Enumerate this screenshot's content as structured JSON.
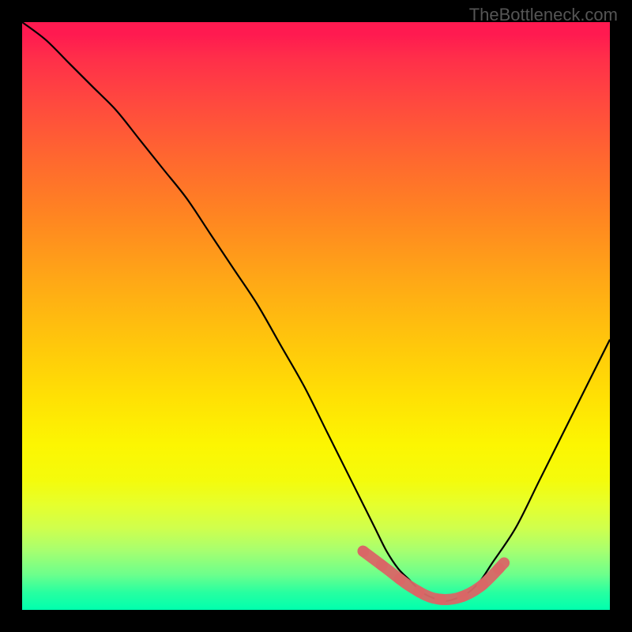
{
  "watermark": "TheBottleneck.com",
  "chart_data": {
    "type": "line",
    "title": "",
    "xlabel": "",
    "ylabel": "",
    "xlim": [
      0,
      100
    ],
    "ylim": [
      0,
      100
    ],
    "series": [
      {
        "name": "bottleneck-curve",
        "x": [
          0,
          4,
          8,
          12,
          16,
          20,
          24,
          28,
          32,
          36,
          40,
          44,
          48,
          52,
          56,
          58,
          60,
          62,
          64,
          66,
          68,
          70,
          72,
          74,
          76,
          78,
          80,
          84,
          88,
          92,
          96,
          100
        ],
        "values": [
          100,
          97,
          93,
          89,
          85,
          80,
          75,
          70,
          64,
          58,
          52,
          45,
          38,
          30,
          22,
          18,
          14,
          10,
          7,
          5,
          3,
          2,
          1.5,
          2,
          3,
          5,
          8,
          14,
          22,
          30,
          38,
          46
        ]
      }
    ],
    "highlight": {
      "name": "optimal-zone",
      "x": [
        58,
        62,
        66,
        70,
        74,
        78,
        82
      ],
      "values": [
        10,
        7,
        4,
        2,
        2,
        4,
        8
      ]
    },
    "background_gradient": {
      "top": "#ff1a50",
      "mid": "#ffe104",
      "bottom": "#00ffae"
    }
  }
}
